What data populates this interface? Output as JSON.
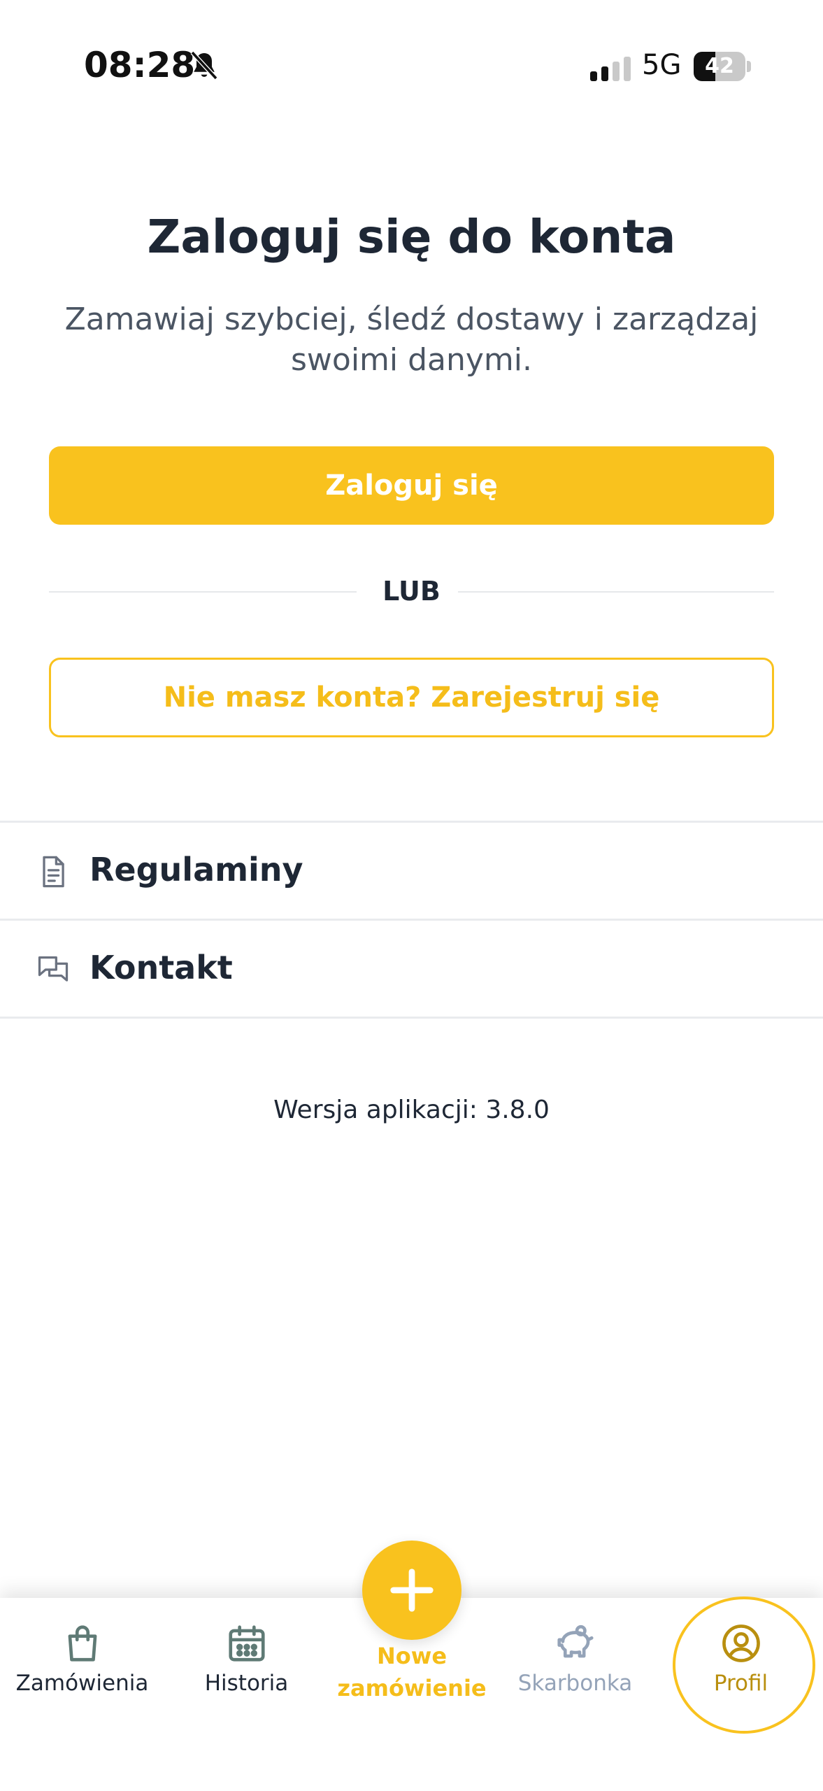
{
  "status_bar": {
    "time": "08:28",
    "network": "5G",
    "battery_level": "42",
    "battery_fraction": 0.42
  },
  "main": {
    "title": "Zaloguj się do konta",
    "subtitle": "Zamawiaj szybciej, śledź dostawy i zarządzaj swoimi danymi.",
    "login_label": "Zaloguj się",
    "or_label": "LUB",
    "register_label": "Nie masz konta? Zarejestruj się"
  },
  "menu": {
    "items": [
      {
        "label": "Regulaminy",
        "icon": "document-icon"
      },
      {
        "label": "Kontakt",
        "icon": "chat-icon"
      }
    ]
  },
  "version": "Wersja aplikacji: 3.8.0",
  "tabbar": {
    "tabs": [
      {
        "label": "Zamówienia",
        "icon": "shopping-bag-icon"
      },
      {
        "label": "Historia",
        "icon": "calendar-icon"
      },
      {
        "label": "Nowe zamówienie",
        "label_line1": "Nowe",
        "label_line2": "zamówienie",
        "icon": "plus-icon"
      },
      {
        "label": "Skarbonka",
        "icon": "piggy-bank-icon"
      },
      {
        "label": "Profil",
        "icon": "user-circle-icon",
        "active": true
      }
    ]
  },
  "colors": {
    "accent": "#f9c21e",
    "accent_text": "#f5bd1a",
    "active_tab": "#b98f0f",
    "text_dark": "#1e2735",
    "text_muted": "#4b5563",
    "tab_muted": "#94a3b8",
    "divider": "#e9ebee"
  }
}
